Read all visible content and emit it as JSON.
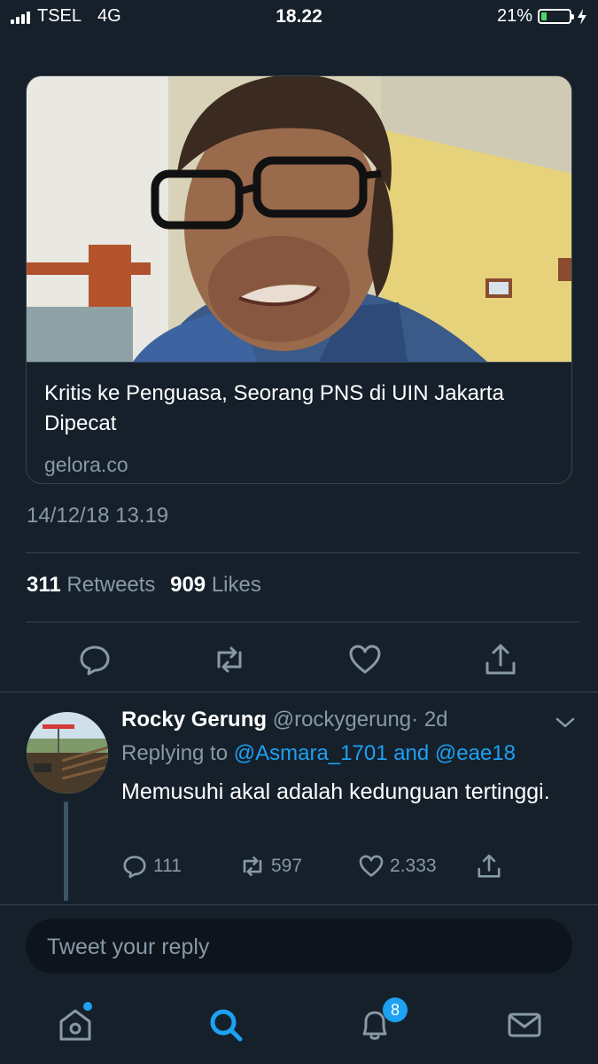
{
  "status_bar": {
    "carrier": "TSEL",
    "network": "4G",
    "time": "18.22",
    "battery": "21%",
    "battery_level": 0.21
  },
  "link_card": {
    "title": "Kritis ke Penguasa, Seorang PNS di UIN Jakarta Dipecat",
    "domain": "gelora.co",
    "image_icon": "news-photo-man-with-glasses"
  },
  "tweet": {
    "timestamp": "14/12/18 13.19",
    "retweet_count": "311",
    "retweet_label": "Retweets",
    "like_count": "909",
    "like_label": "Likes",
    "actions": [
      "reply-icon",
      "retweet-icon",
      "like-icon",
      "share-icon"
    ]
  },
  "reply": {
    "name": "Rocky Gerung",
    "handle": "@rockygerung",
    "age": "· 2d",
    "replying_prefix": "Replying to",
    "replying_to": "@Asmara_1701 and @eae18",
    "text": "Memusuhi akal adalah kedunguan tertinggi.",
    "reply_count": "111",
    "retweet_count": "597",
    "like_count": "2.333"
  },
  "composer": {
    "placeholder": "Tweet your reply"
  },
  "tabbar": {
    "notifications_badge": "8",
    "tabs": [
      "home-icon",
      "search-icon",
      "notifications-icon",
      "messages-icon"
    ]
  },
  "colors": {
    "background": "#15202b",
    "accent": "#1da1f2",
    "secondary_text": "#8899a6",
    "divider": "#38444d"
  }
}
